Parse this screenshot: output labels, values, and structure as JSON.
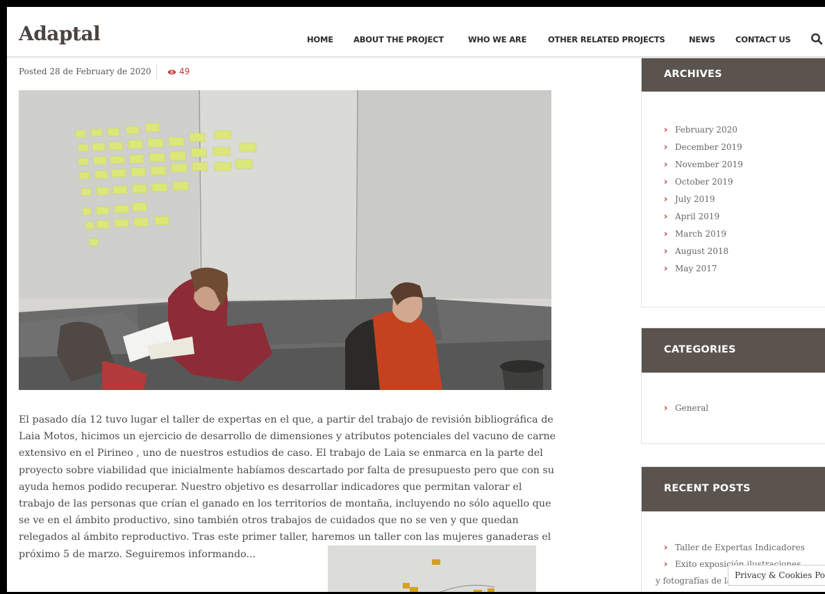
{
  "site": {
    "logo": "Adaptal"
  },
  "nav": {
    "items": [
      "HOME",
      "ABOUT THE PROJECT",
      "WHO WE ARE",
      "OTHER RELATED PROJECTS",
      "NEWS",
      "CONTACT US"
    ],
    "search_icon": "search-icon"
  },
  "post": {
    "date": "Posted 28 de February de 2020",
    "views": "49",
    "views_icon": "eye-icon",
    "body": "El pasado día 12 tuvo lugar el taller de expertas en el que, a partir del trabajo de revisión bibliográfica de Laia Motos, hicimos un ejercicio de desarrollo de dimensiones y atributos potenciales del vacuno de carne extensivo en el Pirineo , uno de nuestros estudios de caso. El trabajo de Laia se enmarca en la parte del proyecto sobre viabilidad que inicialmente habíamos descartado por falta de presupuesto pero que con su ayuda hemos podido recuperar. Nuestro objetivo es desarrollar indicadores que permitan valorar el trabajo de las personas que crían el ganado en los territorios de montaña, incluyendo no sólo aquello que se ve en el ámbito productivo, sino también otros trabajos de cuidados que no se ven y que quedan relegados al ámbito reproductivo. Tras este primer taller, haremos un taller con las mujeres ganaderas el próximo 5 de marzo. Seguiremos informando..."
  },
  "sidebar": {
    "archives": {
      "title": "ARCHIVES",
      "items": [
        "February 2020",
        "December 2019",
        "November 2019",
        "October 2019",
        "July 2019",
        "April 2019",
        "March 2019",
        "August 2018",
        "May 2017"
      ]
    },
    "categories": {
      "title": "CATEGORIES",
      "items": [
        "General"
      ]
    },
    "recent_posts": {
      "title": "RECENT POSTS",
      "items": [
        "Taller de Expertas Indicadores",
        "Exito exposición ilustraciones",
        "y fotografías de la"
      ]
    }
  },
  "privacy_banner": {
    "label": "Privacy & Cookies Policy"
  },
  "colors": {
    "accent": "#c0392b",
    "widget_header": "#5a534e",
    "logo": "#4a4340"
  }
}
